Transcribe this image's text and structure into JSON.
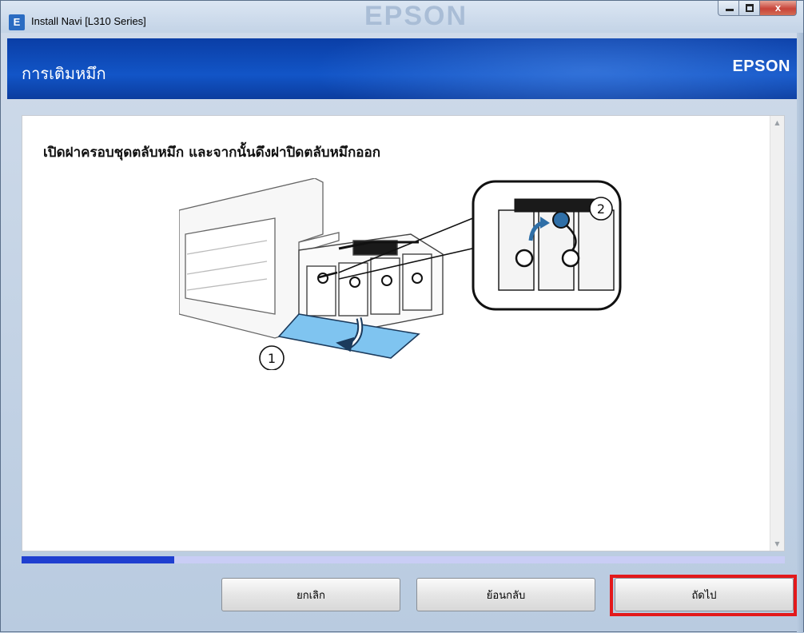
{
  "window": {
    "title": "Install Navi [L310 Series]",
    "app_icon_letter": "E",
    "ghost_watermark": "EPSON",
    "controls": {
      "minimize": "minimize",
      "maximize": "maximize",
      "close": "x"
    }
  },
  "header": {
    "title": "การเติมหมึก",
    "brand": "EPSON"
  },
  "content": {
    "instruction": "เปิดฝาครอบชุดตลับหมึก และจากนั้นดึงฝาปิดตลับหมึกออก",
    "step_labels": [
      "①",
      "②"
    ]
  },
  "progress": {
    "value_percent": 20
  },
  "footer": {
    "cancel_label": "ยกเลิก",
    "back_label": "ย้อนกลับ",
    "next_label": "ถัดไป"
  },
  "colors": {
    "header_blue": "#1255c7",
    "progress_fill": "#1f3fd0",
    "progress_track": "#c9cdf5",
    "highlight": "#e3191b",
    "tank_blue": "#7fc4f0"
  }
}
